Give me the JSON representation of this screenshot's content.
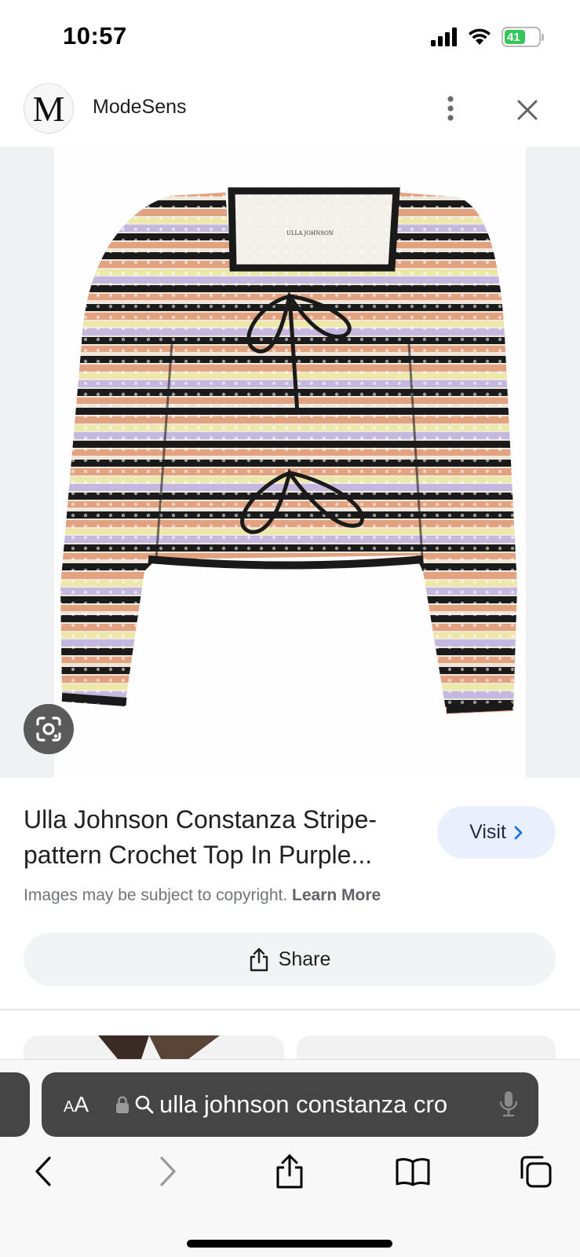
{
  "status_bar": {
    "time": "10:57",
    "battery": "41"
  },
  "site_header": {
    "logo_letter": "M",
    "site_name": "ModeSens"
  },
  "product": {
    "title": "Ulla Johnson Constanza Stripe-pattern Crochet Top In Purple...",
    "visit_label": "Visit",
    "copyright_text": "Images may be subject to copyright.",
    "learn_more": "Learn More",
    "share_label": "Share",
    "image_label": "ULLA JOHNSON"
  },
  "browser": {
    "aa_small": "A",
    "aa_large": "A",
    "url_text": "ulla johnson constanza cro"
  },
  "colors": {
    "accent_visit_bg": "#e9effd",
    "url_bar_bg": "#454545",
    "battery_green": "#34c759",
    "stripe_black": "#1a1a1a",
    "stripe_peach": "#e2a17f",
    "stripe_lavender": "#c4b8e0",
    "stripe_yellow": "#ede8a6",
    "stripe_cream": "#efe7dc"
  }
}
